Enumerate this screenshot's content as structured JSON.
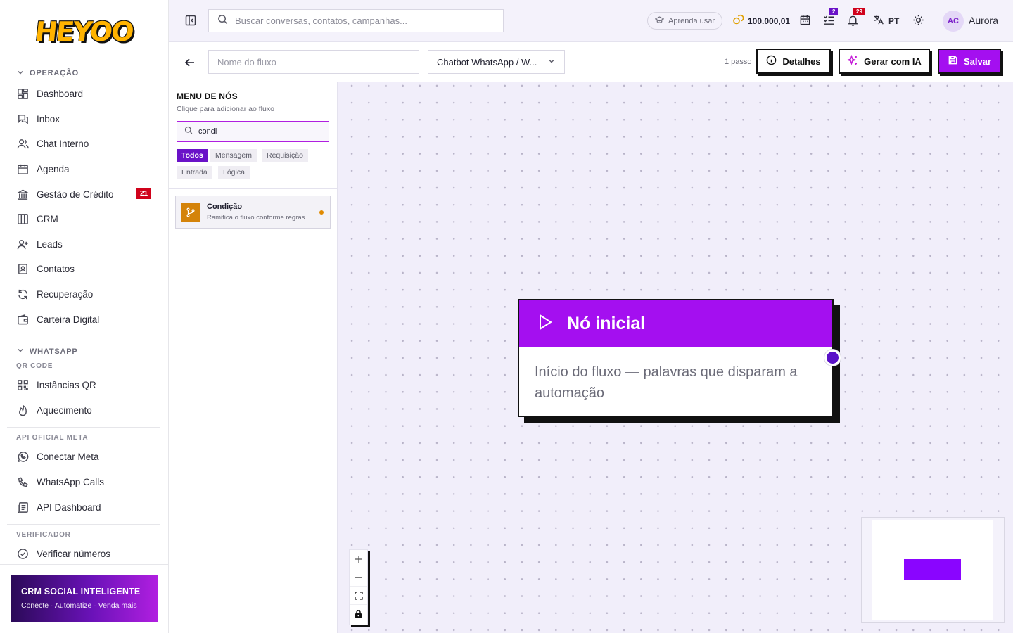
{
  "brand": {
    "logo_text": "HEYOO",
    "accent": "#a40ff0",
    "accent_dark": "#6a12c8"
  },
  "sidebar": {
    "sections": [
      {
        "title": "OPERAÇÃO",
        "items": [
          {
            "label": "Dashboard",
            "icon": "dashboard-icon"
          },
          {
            "label": "Inbox",
            "icon": "inbox-icon"
          },
          {
            "label": "Chat Interno",
            "icon": "users-icon"
          },
          {
            "label": "Agenda",
            "icon": "calendar-icon"
          },
          {
            "label": "Gestão de Crédito",
            "icon": "bank-icon",
            "badge": "21"
          },
          {
            "label": "CRM",
            "icon": "columns-icon"
          },
          {
            "label": "Leads",
            "icon": "user-plus-icon"
          },
          {
            "label": "Contatos",
            "icon": "contact-icon"
          },
          {
            "label": "Recuperação",
            "icon": "refresh-icon"
          },
          {
            "label": "Carteira Digital",
            "icon": "wallet-icon"
          }
        ]
      },
      {
        "title": "WHATSAPP",
        "subtitle": "QR CODE",
        "items": [
          {
            "label": "Instâncias QR",
            "icon": "qr-code-icon"
          },
          {
            "label": "Aquecimento",
            "icon": "flame-icon"
          }
        ]
      },
      {
        "title": "API OFICIAL META",
        "items": [
          {
            "label": "Conectar Meta",
            "icon": "whatsapp-icon"
          },
          {
            "label": "WhatsApp Calls",
            "icon": "phone-icon"
          },
          {
            "label": "API Dashboard",
            "icon": "api-dashboard-icon"
          }
        ]
      },
      {
        "title": "VERIFICADOR",
        "items": [
          {
            "label": "Verificar números",
            "icon": "check-circle-icon"
          }
        ]
      }
    ],
    "promo": {
      "title": "CRM SOCIAL INTELIGENTE",
      "subtitle": "Conecte · Automatize · Venda mais"
    }
  },
  "topbar": {
    "search_placeholder": "Buscar conversas, contatos, campanhas...",
    "learn_label": "Aprenda usar",
    "credits": "100.000,01",
    "tasks_count": "2",
    "notifications_count": "29",
    "language": "PT",
    "user_initials": "AC",
    "user_name": "Aurora"
  },
  "flow": {
    "name_placeholder": "Nome do fluxo",
    "type_value": "Chatbot WhatsApp / W...",
    "steps_label": "1 passo",
    "details_label": "Detalhes",
    "ai_label": "Gerar com IA",
    "save_label": "Salvar"
  },
  "node_menu": {
    "title": "MENU DE NÓS",
    "subtitle": "Clique para adicionar ao fluxo",
    "search_value": "condi",
    "filters": [
      "Todos",
      "Mensagem",
      "Requisição",
      "Entrada",
      "Lógica"
    ],
    "active_filter": "Todos",
    "results": [
      {
        "title": "Condição",
        "description": "Ramifica o fluxo conforme regras",
        "icon": "branch-icon",
        "color": "#d4830a"
      }
    ]
  },
  "canvas": {
    "start_node": {
      "title": "Nó inicial",
      "body": "Início do fluxo — palavras que disparam a automação",
      "icon": "play-icon"
    },
    "zoom_controls": [
      "zoom-in",
      "zoom-out",
      "fit-view",
      "lock"
    ]
  }
}
